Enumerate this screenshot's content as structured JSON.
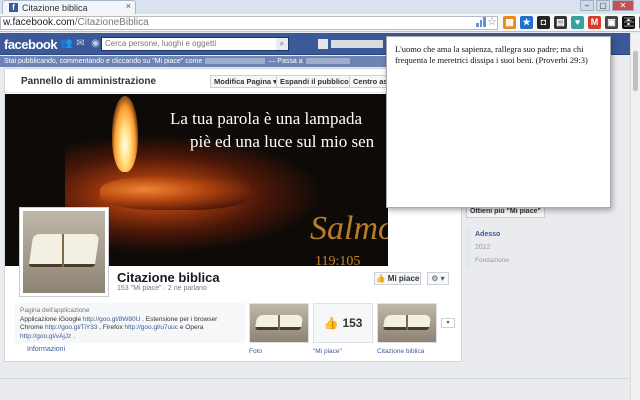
{
  "browser": {
    "tab_title": "Citazione biblica",
    "tab_close": "×",
    "url_host": "w.facebook.com",
    "url_path": "/CitazioneBiblica",
    "window_controls": [
      "–",
      "▢",
      "✕"
    ],
    "extensions": [
      {
        "name": "rss-icon",
        "color": "#e88a22",
        "glyph": "▦"
      },
      {
        "name": "bookmark-star-icon",
        "color": "#1f6fd0",
        "glyph": "★"
      },
      {
        "name": "camera-icon",
        "color": "#222222",
        "glyph": "◘"
      },
      {
        "name": "dictionary-icon",
        "color": "#333333",
        "glyph": "▤"
      },
      {
        "name": "heart-icon",
        "color": "#3aa0a0",
        "glyph": "♥"
      },
      {
        "name": "gmail-icon",
        "color": "#d93b2b",
        "glyph": "M"
      },
      {
        "name": "gift-icon",
        "color": "#444444",
        "glyph": "▣"
      },
      {
        "name": "citazione-extension-icon",
        "color": "#111111",
        "glyph": "✚"
      },
      {
        "name": "image-extension-icon",
        "color": "#555555",
        "glyph": "▨"
      },
      {
        "name": "recycle-icon",
        "color": "#3a8a3a",
        "glyph": "♻"
      }
    ]
  },
  "facebook": {
    "logo": "facebook",
    "search_placeholder": "Cerca persone, luoghi e oggetti",
    "home_label": "",
    "notice_prefix": "Stai pubblicando, commentando e cliccando su \"Mi piace\" come",
    "notice_switch": "— Passa a"
  },
  "page": {
    "admin_title": "Pannello di amministrazione",
    "admin_buttons": [
      "Modifica Pagina ▾",
      "Espandi il pubblico ▾",
      "Centro assis"
    ],
    "cover_line1": "La tua parola è una lampada",
    "cover_line2": "piè ed una luce sul mio sen",
    "cover_salmo": "Salmo",
    "cover_verse": "119:105",
    "name": "Citazione biblica",
    "subtitle": "153 \"Mi piace\" · 2 ne parlano",
    "like_button": "👍 Mi piace",
    "gear_button": "⚙ ▾",
    "about_category": "Pagina dell'applicazione",
    "about_text1": "Applicazione iGoogle ",
    "about_link1": "http://goo.gl/8W80U",
    "about_text2": " . Estensione per i browser Chrome ",
    "about_link2": "http://goo.gl/TiY33",
    "about_text3": " , Firefox ",
    "about_link3": "http://goo.gl/u7uuc",
    "about_text4": " e Opera ",
    "about_link4": "http://goo.gl/vAjJz",
    "about_text5": " .",
    "info_link": "Informazioni",
    "apps": [
      {
        "label": "Foto"
      },
      {
        "label": "\"Mi piace\"",
        "count": "153"
      },
      {
        "label": "Citazione biblica"
      }
    ],
    "apps_more": "▾"
  },
  "right_column": {
    "like_button": "Ottieni più \"Mi piace\"",
    "timeline_now": "Adesso",
    "timeline_year": "2012",
    "timeline_founded": "Fondazione"
  },
  "popup": {
    "quote": "L'uomo che ama la sapienza, rallegra suo padre; ma chi frequenta le meretrici dissipa i suoi beni. (Proverbi 29:3)"
  }
}
